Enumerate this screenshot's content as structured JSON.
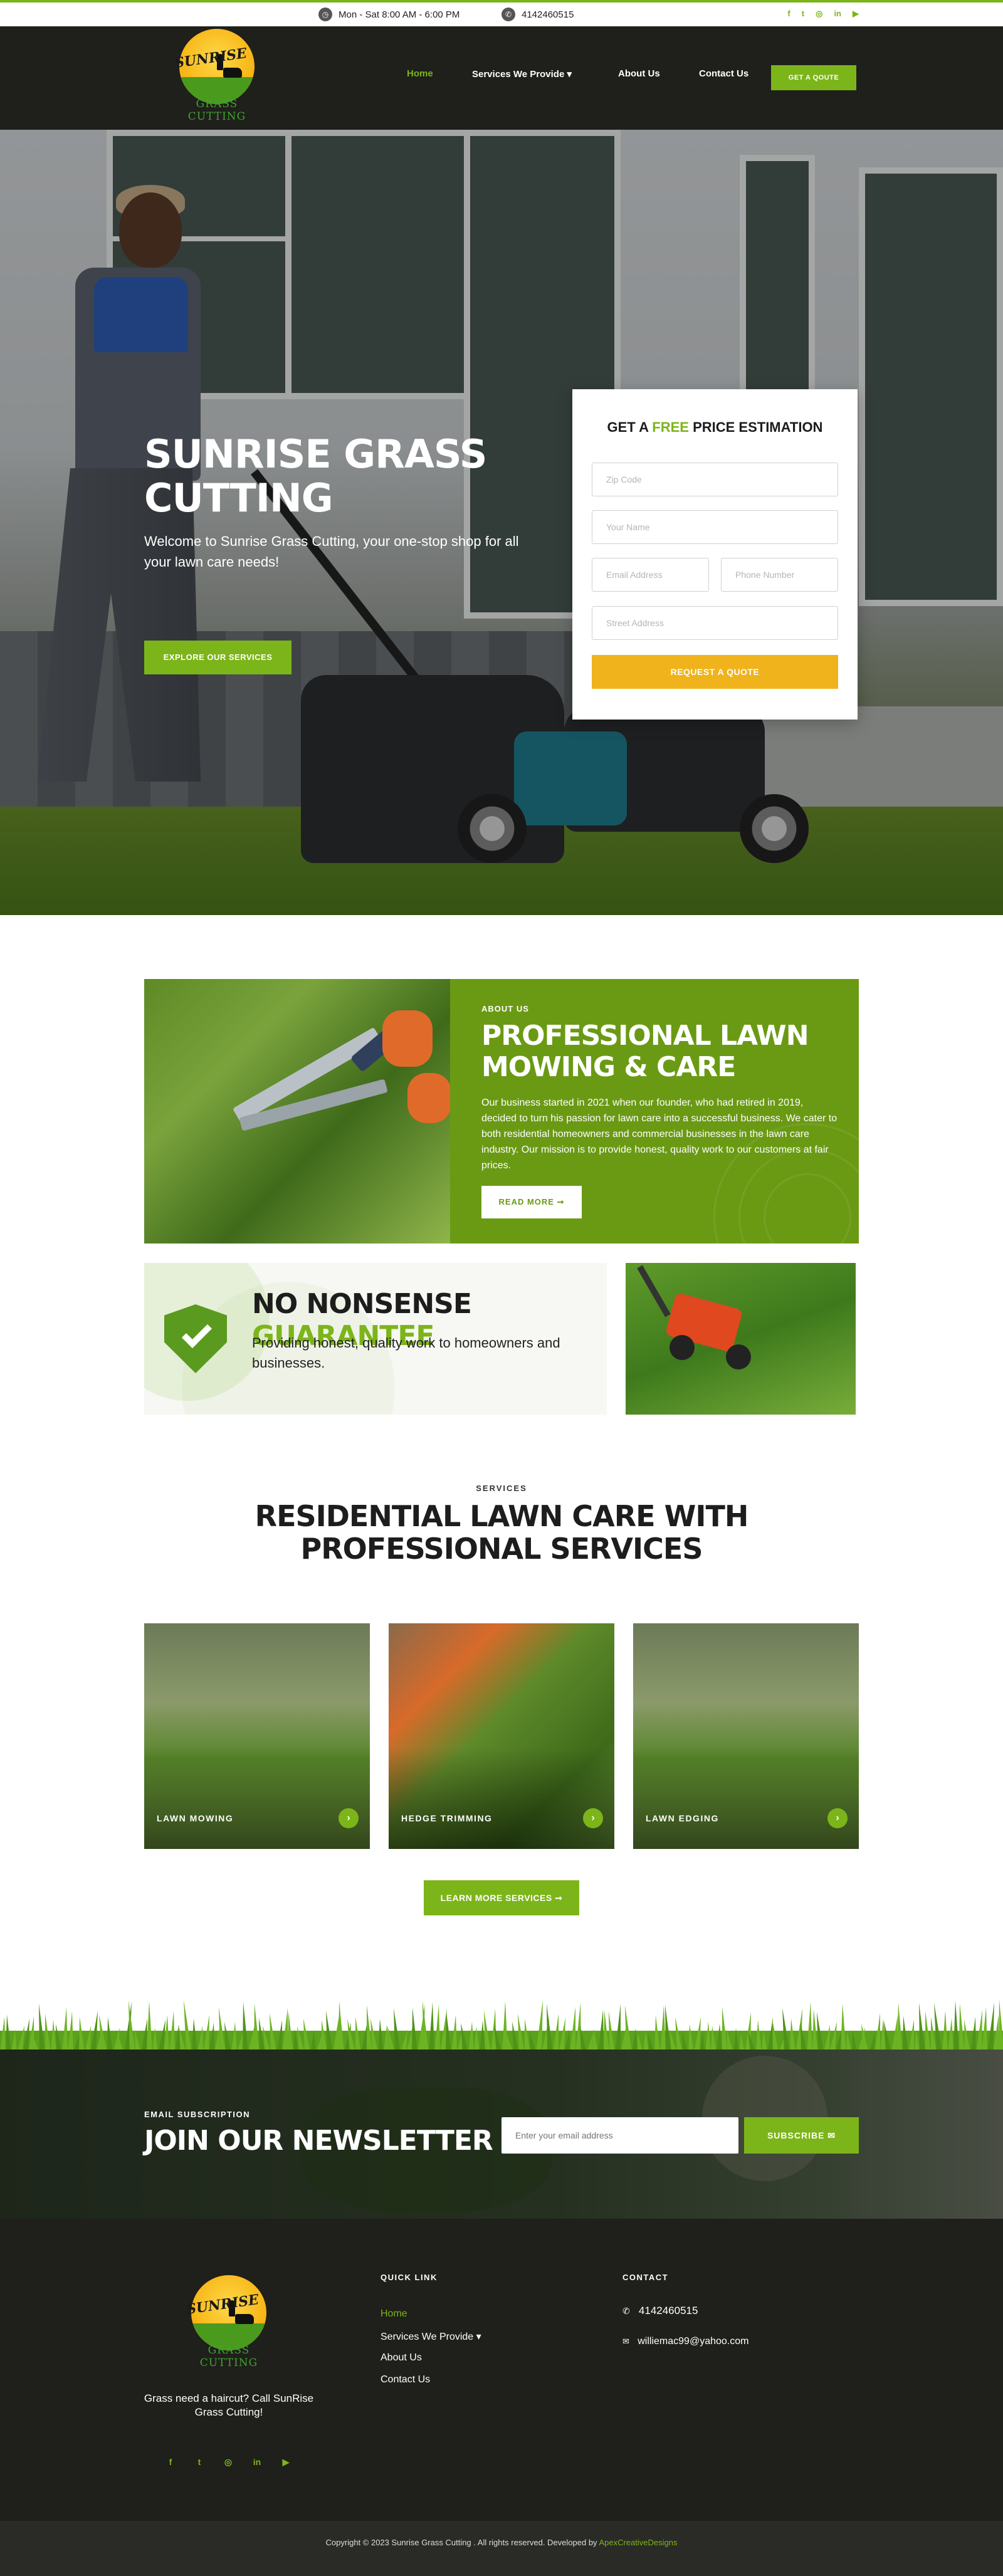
{
  "colors": {
    "accent": "#7cb51a",
    "quote_button": "#f0b31c",
    "dark": "#1f1f1b",
    "about_bg": "#6a9a14"
  },
  "topbar": {
    "hours_icon": "clock-icon",
    "hours": "Mon - Sat 8:00 AM - 6:00 PM",
    "phone_icon": "phone-icon",
    "phone": "4142460515",
    "social": [
      "f",
      "t",
      "◎",
      "in",
      "▶"
    ]
  },
  "logo": {
    "title": "SUNRISE",
    "subtitle": "GRASS CUTTING"
  },
  "nav": {
    "home": "Home",
    "services": "Services We Provide",
    "about": "About Us",
    "contact": "Contact Us",
    "cta": "GET A QOUTE"
  },
  "hero": {
    "title": "SUNRISE GRASS CUTTING",
    "subtitle": "Welcome to Sunrise Grass Cutting, your one-stop shop for all your lawn care needs!",
    "button": "EXPLORE OUR SERVICES"
  },
  "quote_form": {
    "title_pre": "GET A ",
    "title_hl": "FREE",
    "title_post": " PRICE ESTIMATION",
    "zip_placeholder": "Zip Code",
    "name_placeholder": "Your Name",
    "email_placeholder": "Email Address",
    "phone_placeholder": "Phone Number",
    "street_placeholder": "Street Address",
    "submit": "REQUEST A QUOTE"
  },
  "about": {
    "label": "ABOUT US",
    "title": "PROFESSIONAL LAWN MOWING & CARE",
    "text": "Our business started in 2021 when our founder, who had retired in 2019, decided to turn his passion for lawn care into a successful business. We cater to both residential homeowners and commercial businesses in the lawn care industry. Our mission is to provide honest, quality work to our customers at fair prices.",
    "button": "READ MORE ➞"
  },
  "guarantee": {
    "title_pre": "NO NONSENSE ",
    "title_hl": "GUARANTEE",
    "text": "Providing honest, quality work to homeowners and businesses."
  },
  "services": {
    "label": "SERVICES",
    "title": "RESIDENTIAL LAWN CARE WITH PROFESSIONAL SERVICES",
    "cards": [
      {
        "label": "LAWN MOWING"
      },
      {
        "label": "HEDGE TRIMMING"
      },
      {
        "label": "LAWN EDGING"
      }
    ],
    "button": "LEARN MORE SERVICES ➞"
  },
  "newsletter": {
    "label": "EMAIL SUBSCRIPTION",
    "title": "JOIN OUR NEWSLETTER",
    "placeholder": "Enter your email address",
    "button": "SUBSCRIBE  ✉"
  },
  "footer": {
    "tagline": "Grass need a haircut? Call SunRise Grass Cutting!",
    "social": [
      "f",
      "t",
      "◎",
      "in",
      "▶"
    ],
    "quick_link_heading": "QUICK LINK",
    "links": [
      "Home",
      "Services We Provide",
      "About Us",
      "Contact Us"
    ],
    "contact_heading": "CONTACT",
    "phone": "4142460515",
    "email": "williemac99@yahoo.com",
    "copyright_pre": "Copyright © 2023 Sunrise Grass Cutting . All rights reserved. Developed by ",
    "developer": "ApexCreativeDesigns"
  }
}
